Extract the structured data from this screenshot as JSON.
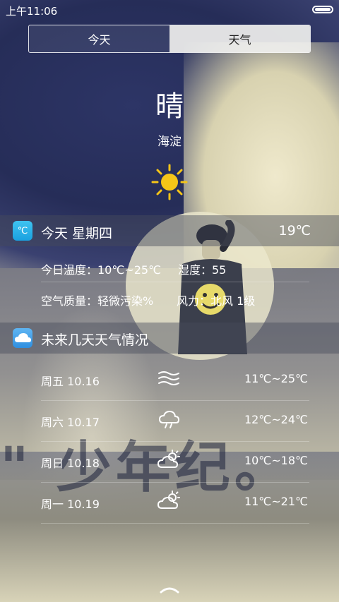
{
  "status_bar": {
    "time": "上午11:06"
  },
  "tabs": [
    {
      "label": "今天"
    },
    {
      "label": "天气"
    }
  ],
  "current": {
    "condition": "晴",
    "location": "海淀",
    "icon": "sun-icon"
  },
  "today": {
    "header": "今天 星期四",
    "temperature": "19℃",
    "temp_range": "今日温度：10℃~25℃",
    "humidity": "湿度：55",
    "air_quality": "空气质量：轻微污染%",
    "wind": "风力：北风 1级"
  },
  "forecast": {
    "header": "未来几天天气情况",
    "days": [
      {
        "day": "周五 10.16",
        "icon": "haze-icon",
        "temp": "11℃~25℃"
      },
      {
        "day": "周六 10.17",
        "icon": "cloud-rain-icon",
        "temp": "12℃~24℃"
      },
      {
        "day": "周日 10.18",
        "icon": "partly-cloudy-icon",
        "temp": "10℃~18℃"
      },
      {
        "day": "周一 10.19",
        "icon": "partly-cloudy-icon",
        "temp": "11℃~21℃"
      }
    ]
  },
  "wallpaper_text": "\" 少年纪。",
  "colors": {
    "tab_inactive_bg": "#f0f0ee",
    "sun": "#f5c518",
    "accent_icon": "#1aa1e0"
  }
}
